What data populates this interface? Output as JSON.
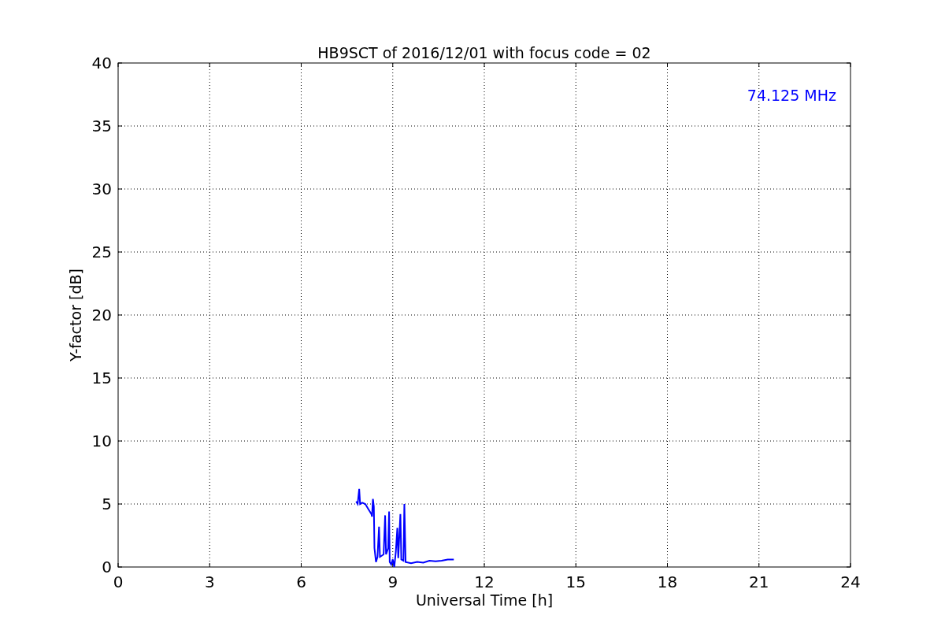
{
  "figure": {
    "chart_data": {
      "type": "line",
      "title": "HB9SCT of 2016/12/01 with focus code = 02",
      "xlabel": "Universal Time [h]",
      "ylabel": "Y-factor [dB]",
      "xlim": [
        0,
        24
      ],
      "ylim": [
        0,
        40
      ],
      "xticks": [
        0,
        3,
        6,
        9,
        12,
        15,
        18,
        21,
        24
      ],
      "yticks": [
        0,
        5,
        10,
        15,
        20,
        25,
        30,
        35,
        40
      ],
      "x": [
        7.8,
        7.85,
        7.9,
        7.93,
        8.0,
        8.1,
        8.2,
        8.3,
        8.32,
        8.35,
        8.38,
        8.4,
        8.45,
        8.5,
        8.55,
        8.58,
        8.7,
        8.75,
        8.78,
        8.85,
        8.88,
        8.9,
        8.95,
        9.0,
        9.05,
        9.1,
        9.15,
        9.18,
        9.25,
        9.28,
        9.35,
        9.38,
        9.42,
        9.6,
        9.8,
        10.0,
        10.2,
        10.4,
        10.6,
        10.8,
        11.0
      ],
      "grid": true,
      "series": [
        {
          "name": "74.125 MHz",
          "color": "#0000ff",
          "values": [
            5.2,
            5.0,
            6.2,
            5.0,
            5.1,
            5.0,
            4.6,
            4.2,
            4.0,
            5.4,
            4.8,
            1.5,
            0.4,
            0.8,
            3.2,
            0.8,
            1.0,
            4.1,
            1.0,
            1.5,
            4.4,
            0.4,
            0.2,
            0.6,
            0.0,
            1.2,
            3.1,
            0.7,
            4.2,
            0.6,
            0.5,
            5.0,
            0.4,
            0.3,
            0.4,
            0.35,
            0.5,
            0.45,
            0.5,
            0.6,
            0.6
          ]
        }
      ]
    }
  }
}
